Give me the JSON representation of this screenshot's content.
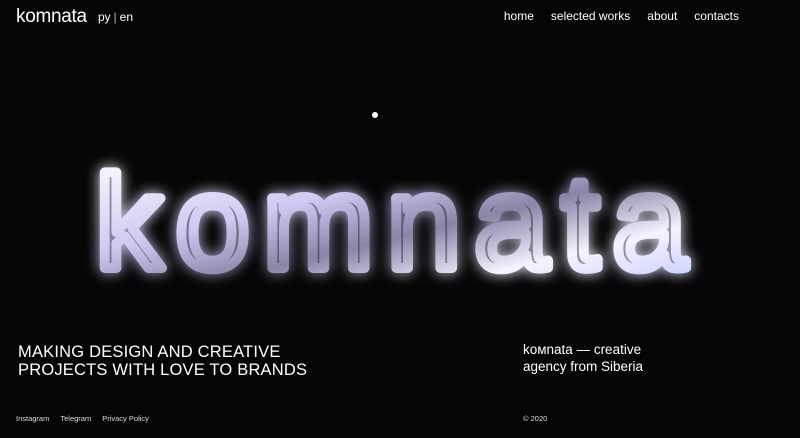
{
  "header": {
    "logo": "komnata",
    "lang": {
      "ru": "ру",
      "separator": "|",
      "en": "en"
    },
    "nav": [
      "home",
      "selected works",
      "about",
      "contacts"
    ]
  },
  "hero": {
    "word": "komnata",
    "tagline": [
      "MAKING DESIGN AND CREATIVE",
      "PROJECTS WITH LOVE TO BRANDS"
    ],
    "agency": [
      "kомnata — creative",
      "agency from Siberia"
    ]
  },
  "footer": {
    "social": [
      "Instagram",
      "Telegram",
      "Privacy Policy"
    ],
    "copyright": "© 2020"
  },
  "colors": {
    "background": "#050505",
    "text": "#ffffff",
    "glass_tint": "#d8d4ff"
  }
}
